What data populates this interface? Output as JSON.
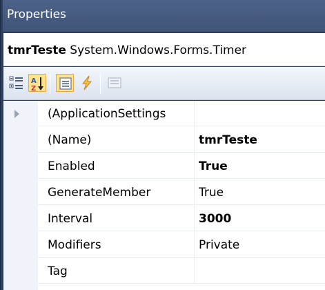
{
  "window": {
    "title": "Properties"
  },
  "object": {
    "name": "tmrTeste",
    "type": "System.Windows.Forms.Timer"
  },
  "toolbar": {
    "buttons": [
      {
        "icon": "categorized-icon",
        "active": false
      },
      {
        "icon": "alphabetical-icon",
        "active": true
      },
      {
        "icon": "properties-icon",
        "active": true
      },
      {
        "icon": "events-icon",
        "active": false
      },
      {
        "icon": "property-pages-icon",
        "active": false
      }
    ]
  },
  "properties": [
    {
      "name": "(ApplicationSettings",
      "value": "",
      "bold": false,
      "expandable": true
    },
    {
      "name": "(Name)",
      "value": "tmrTeste",
      "bold": true,
      "expandable": false
    },
    {
      "name": "Enabled",
      "value": "True",
      "bold": true,
      "expandable": false
    },
    {
      "name": "GenerateMember",
      "value": "True",
      "bold": false,
      "expandable": false
    },
    {
      "name": "Interval",
      "value": "3000",
      "bold": true,
      "expandable": false
    },
    {
      "name": "Modifiers",
      "value": "Private",
      "bold": false,
      "expandable": false
    },
    {
      "name": "Tag",
      "value": "",
      "bold": false,
      "expandable": false
    }
  ]
}
